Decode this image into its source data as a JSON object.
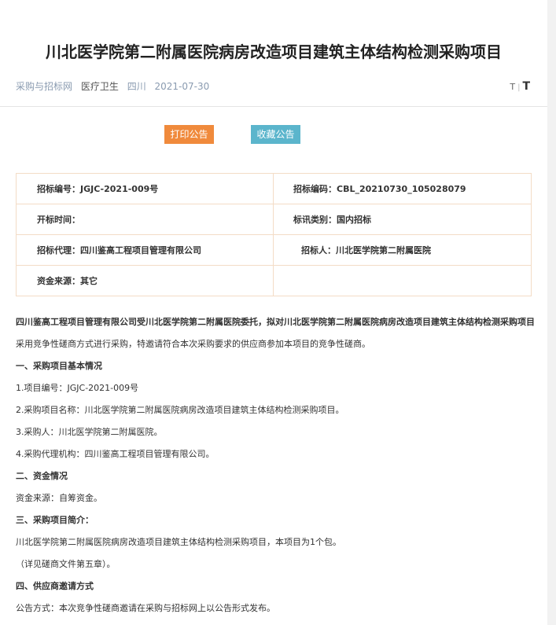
{
  "page": {
    "title": "川北医学院第二附属医院病房改造项目建筑主体结构检测采购项目"
  },
  "meta": {
    "source": "采购与招标网",
    "industry": "医疗卫生",
    "region": "四川",
    "date": "2021-07-30"
  },
  "font_size_control": {
    "small": "T",
    "separator": "|",
    "big": "T"
  },
  "buttons": {
    "print": "打印公告",
    "collect": "收藏公告"
  },
  "info": {
    "bid_no_label": "招标编号：",
    "bid_no_value": "JGJC-2021-009号",
    "bid_code_label": "招标编码：",
    "bid_code_value": "CBL_20210730_105028079",
    "open_time_label": "开标时间：",
    "open_time_value": "",
    "category_label": "标讯类别：",
    "category_value": "国内招标",
    "agent_label": "招标代理：",
    "agent_value": "四川鉴高工程项目管理有限公司",
    "purchaser_label": "招标人：",
    "purchaser_value": "川北医学院第二附属医院",
    "fund_label": "资金来源：",
    "fund_value": "其它"
  },
  "content": [
    {
      "text": "四川鉴高工程项目管理有限公司受川北医学院第二附属医院委托，拟对川北医学院第二附属医院病房改造项目建筑主体结构检测采购项目",
      "bold": true
    },
    {
      "text": "采用竞争性磋商方式进行采购，特邀请符合本次采购要求的供应商参加本项目的竞争性磋商。",
      "bold": false
    },
    {
      "text": "一、采购项目基本情况",
      "bold": true
    },
    {
      "text": "1.项目编号：JGJC-2021-009号",
      "bold": false
    },
    {
      "text": "2.采购项目名称：川北医学院第二附属医院病房改造项目建筑主体结构检测采购项目。",
      "bold": false
    },
    {
      "text": "3.采购人：川北医学院第二附属医院。",
      "bold": false
    },
    {
      "text": "4.采购代理机构：四川鉴高工程项目管理有限公司。",
      "bold": false
    },
    {
      "text": "二、资金情况",
      "bold": true
    },
    {
      "text": "资金来源：自筹资金。",
      "bold": false
    },
    {
      "text": "三、采购项目简介：",
      "bold": true
    },
    {
      "text": "川北医学院第二附属医院病房改造项目建筑主体结构检测采购项目，本项目为1个包。",
      "bold": false
    },
    {
      "text": "（详见磋商文件第五章）。",
      "bold": false
    },
    {
      "text": "四、供应商邀请方式",
      "bold": true
    },
    {
      "text": "公告方式：本次竞争性磋商邀请在采购与招标网上以公告形式发布。",
      "bold": false
    }
  ]
}
